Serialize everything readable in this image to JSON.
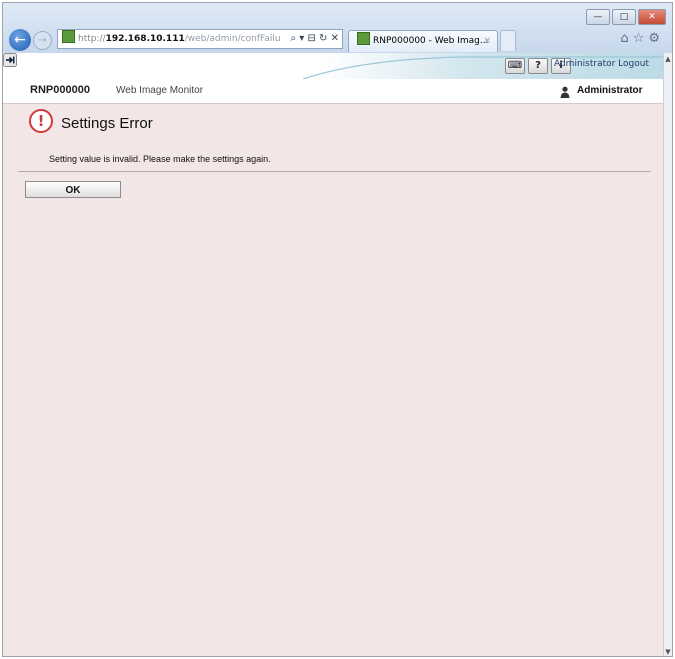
{
  "browser": {
    "url_prefix": "http://",
    "url_host": "192.168.10.111",
    "url_path": "/web/admin/confFailu",
    "address_controls": "⌕ ▾ ⊟ ↻ ✕",
    "tab_title": "RNP000000 - Web Imag...",
    "tab_close": "×",
    "window_min": "—",
    "window_max": "□",
    "window_close": "✕",
    "back_glyph": "←",
    "forward_glyph": "→",
    "home_icon": "⌂",
    "star_icon": "☆",
    "settings_icon": "⚙"
  },
  "toolbar": {
    "icons": [
      "keyboard-icon",
      "help-icon",
      "info-icon",
      "logout-icon"
    ],
    "help_glyph": "?",
    "info_glyph": "i",
    "logout_label": "Administrator Logout"
  },
  "header": {
    "device_name": "RNP000000",
    "product_name": "Web Image Monitor",
    "user_label": "Administrator"
  },
  "error": {
    "icon_glyph": "!",
    "title": "Settings Error",
    "message": "Setting value is invalid. Please make the settings again.",
    "ok_label": "OK"
  },
  "colors": {
    "page_background": "#f3e6e6",
    "error_red": "#d23a3a",
    "link_blue": "#213d6e"
  }
}
